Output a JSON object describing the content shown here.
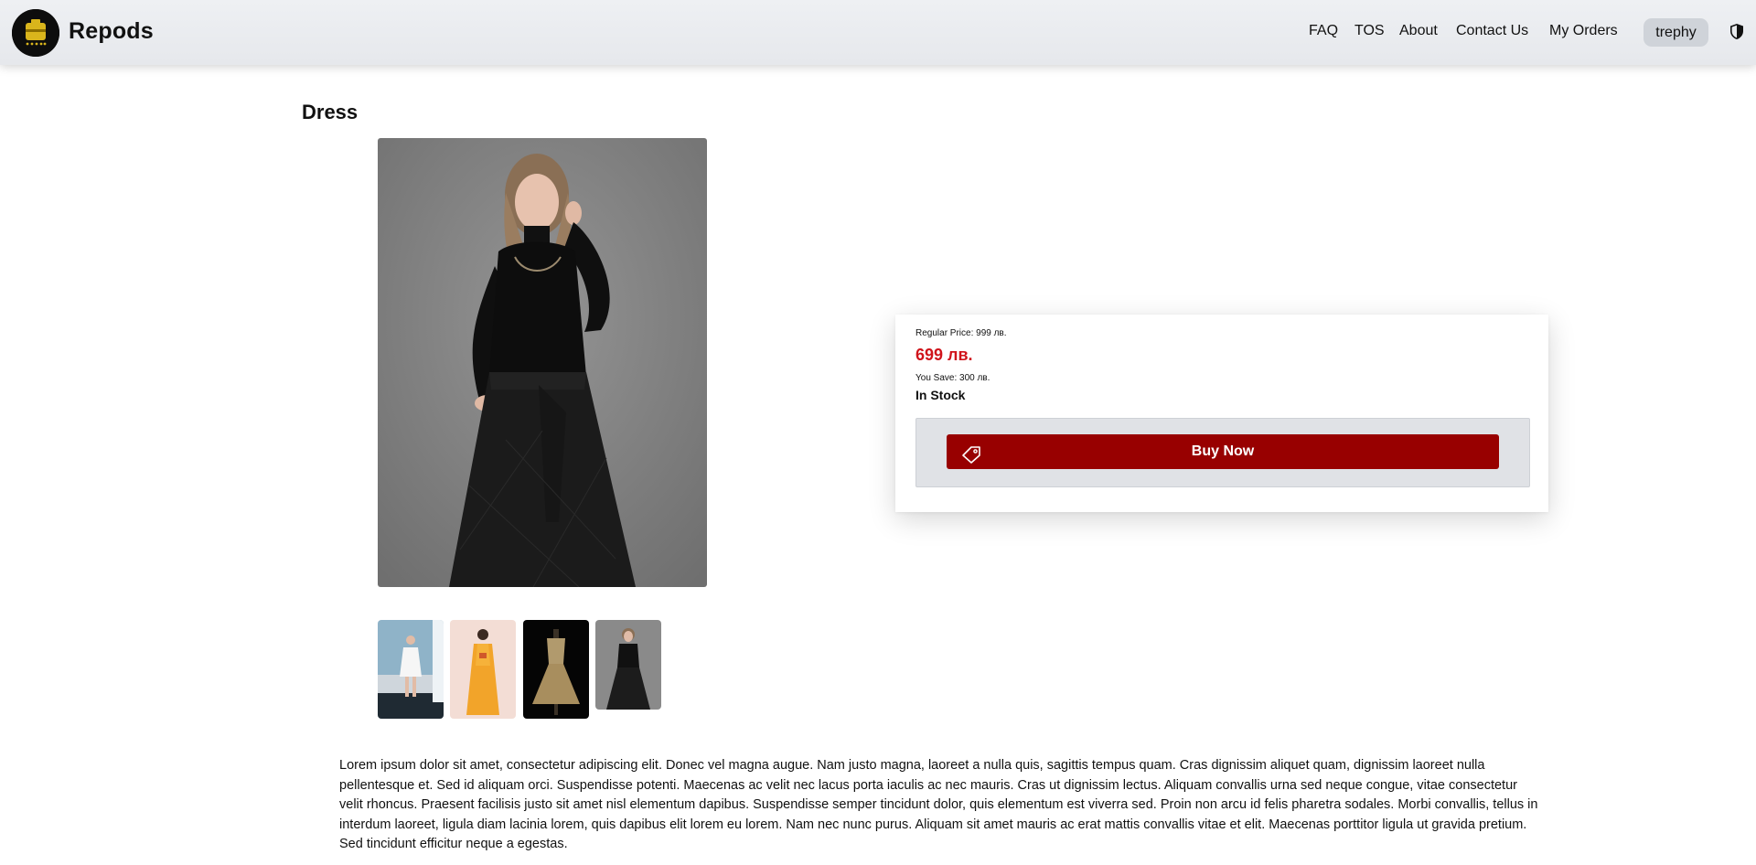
{
  "header": {
    "brand": "Repods",
    "nav": [
      "FAQ",
      "TOS",
      "About",
      "Contact Us",
      "My Orders"
    ],
    "user": "trephy"
  },
  "product": {
    "title": "Dress",
    "regular_price": "Regular Price: 999 лв.",
    "price": "699 лв.",
    "you_save": "You Save: 300 лв.",
    "stock": "In Stock",
    "buy_label": "Buy Now",
    "description": "Lorem ipsum dolor sit amet, consectetur adipiscing elit. Donec vel magna augue. Nam justo magna, laoreet a nulla quis, sagittis tempus quam. Cras dignissim aliquet quam, dignissim laoreet nulla pellentesque et. Sed id aliquam orci. Suspendisse potenti. Maecenas ac velit nec lacus porta iaculis ac nec mauris. Cras ut dignissim lectus. Aliquam convallis urna sed neque congue, vitae consectetur velit rhoncus. Praesent facilisis justo sit amet nisl elementum dapibus. Suspendisse semper tincidunt dolor, quis elementum est viverra sed. Proin non arcu id felis pharetra sodales. Morbi convallis, tellus in interdum laoreet, ligula diam lacinia lorem, quis dapibus elit lorem eu lorem. Nam nec nunc purus. Aliquam sit amet mauris ac erat mattis convallis vitae et elit. Maecenas porttitor ligula ut gravida pretium. Sed tincidunt efficitur neque a egestas."
  },
  "thumbnails": [
    {
      "label": "white-dress"
    },
    {
      "label": "orange-dress"
    },
    {
      "label": "gold-dress"
    },
    {
      "label": "black-dress"
    }
  ],
  "icons": {
    "logo": "logo-icon",
    "shield": "shield-icon",
    "tag": "tag-icon"
  },
  "colors": {
    "accent": "#980000",
    "sale_price": "#d0141b",
    "header_bg": "#e9ebee",
    "pill_bg": "#cfd3d9"
  }
}
